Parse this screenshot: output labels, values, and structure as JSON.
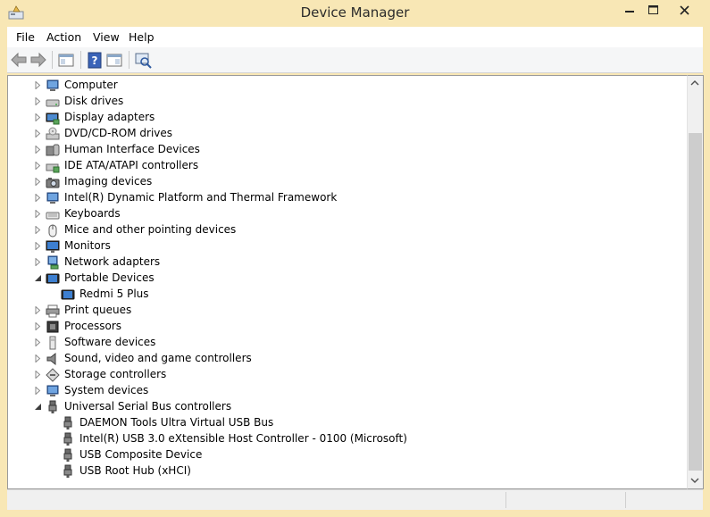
{
  "window": {
    "title": "Device Manager",
    "frame_color": "#f8e7b5",
    "close_glyph": "✕",
    "minimize_glyph": "—",
    "maximize_glyph": "☐"
  },
  "menu": [
    "File",
    "Action",
    "View",
    "Help"
  ],
  "toolbar": {
    "buttons": [
      "back-arrow-icon",
      "forward-arrow-icon",
      "show-hide-console-tree-icon",
      "help-icon",
      "properties-view-icon",
      "scan-hardware-changes-icon"
    ]
  },
  "tree": {
    "items": [
      {
        "label": "Computer",
        "expanded": false,
        "icon": "computer-icon",
        "level": 0
      },
      {
        "label": "Disk drives",
        "expanded": false,
        "icon": "disk-drive-icon",
        "level": 0
      },
      {
        "label": "Display adapters",
        "expanded": false,
        "icon": "display-adapter-icon",
        "level": 0
      },
      {
        "label": "DVD/CD-ROM drives",
        "expanded": false,
        "icon": "dvd-drive-icon",
        "level": 0
      },
      {
        "label": "Human Interface Devices",
        "expanded": false,
        "icon": "hid-icon",
        "level": 0
      },
      {
        "label": "IDE ATA/ATAPI controllers",
        "expanded": false,
        "icon": "ide-controller-icon",
        "level": 0
      },
      {
        "label": "Imaging devices",
        "expanded": false,
        "icon": "camera-icon",
        "level": 0
      },
      {
        "label": "Intel(R) Dynamic Platform and Thermal Framework",
        "expanded": false,
        "icon": "computer-icon",
        "level": 0
      },
      {
        "label": "Keyboards",
        "expanded": false,
        "icon": "keyboard-icon",
        "level": 0
      },
      {
        "label": "Mice and other pointing devices",
        "expanded": false,
        "icon": "mouse-icon",
        "level": 0
      },
      {
        "label": "Monitors",
        "expanded": false,
        "icon": "monitor-icon",
        "level": 0
      },
      {
        "label": "Network adapters",
        "expanded": false,
        "icon": "network-adapter-icon",
        "level": 0
      },
      {
        "label": "Portable Devices",
        "expanded": true,
        "icon": "portable-device-icon",
        "level": 0
      },
      {
        "label": "Redmi 5 Plus",
        "icon": "portable-device-icon",
        "level": 1
      },
      {
        "label": "Print queues",
        "expanded": false,
        "icon": "printer-icon",
        "level": 0
      },
      {
        "label": "Processors",
        "expanded": false,
        "icon": "processor-icon",
        "level": 0
      },
      {
        "label": "Software devices",
        "expanded": false,
        "icon": "software-device-icon",
        "level": 0
      },
      {
        "label": "Sound, video and game controllers",
        "expanded": false,
        "icon": "speaker-icon",
        "level": 0
      },
      {
        "label": "Storage controllers",
        "expanded": false,
        "icon": "storage-controller-icon",
        "level": 0
      },
      {
        "label": "System devices",
        "expanded": false,
        "icon": "computer-icon",
        "level": 0
      },
      {
        "label": "Universal Serial Bus controllers",
        "expanded": true,
        "icon": "usb-icon",
        "level": 0
      },
      {
        "label": "DAEMON Tools Ultra Virtual USB Bus",
        "icon": "usb-icon",
        "level": 1
      },
      {
        "label": "Intel(R) USB 3.0 eXtensible Host Controller - 0100 (Microsoft)",
        "icon": "usb-icon",
        "level": 1
      },
      {
        "label": "USB Composite Device",
        "icon": "usb-icon",
        "level": 1
      },
      {
        "label": "USB Root Hub (xHCI)",
        "icon": "usb-icon",
        "level": 1
      }
    ]
  }
}
